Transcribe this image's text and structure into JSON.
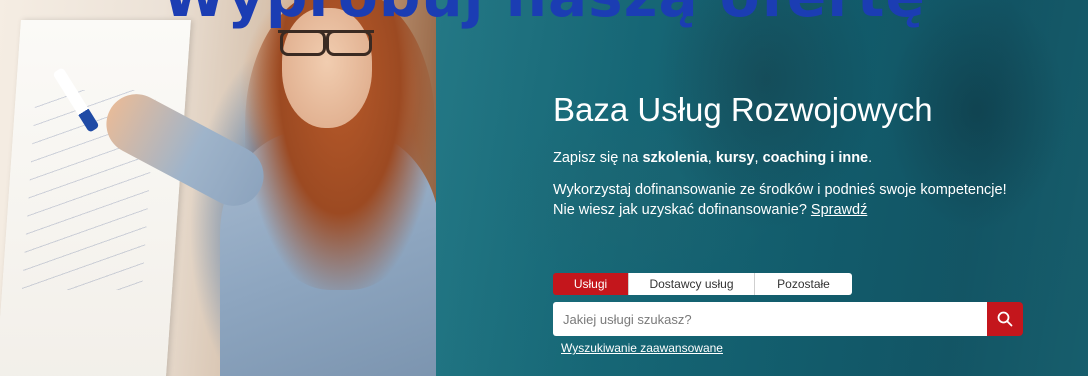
{
  "header": {
    "top_text": "Wypróbuj naszą ofertę"
  },
  "hero": {
    "title": "Baza Usług Rozwojowych",
    "line1_prefix": "Zapisz się na ",
    "line1_bold_1": "szkolenia",
    "line1_sep_1": ", ",
    "line1_bold_2": "kursy",
    "line1_sep_2": ", ",
    "line1_bold_3": "coaching i inne",
    "line1_suffix": ".",
    "line2": "Wykorzystaj dofinansowanie ze środków i podnieś swoje kompetencje!",
    "line3_prefix": "Nie wiesz jak uzyskać dofinansowanie? ",
    "line3_link": "Sprawdź"
  },
  "search": {
    "tabs": [
      {
        "label": "Usługi",
        "active": true
      },
      {
        "label": "Dostawcy usług",
        "active": false
      },
      {
        "label": "Pozostałe",
        "active": false
      }
    ],
    "placeholder": "Jakiej usługi szukasz?",
    "value": "",
    "button_icon": "search-icon",
    "advanced_link": "Wyszukiwanie zaawansowane"
  },
  "colors": {
    "accent_red": "#c4161c",
    "overlay_teal": "#1c6f7e",
    "text_white": "#ffffff"
  }
}
